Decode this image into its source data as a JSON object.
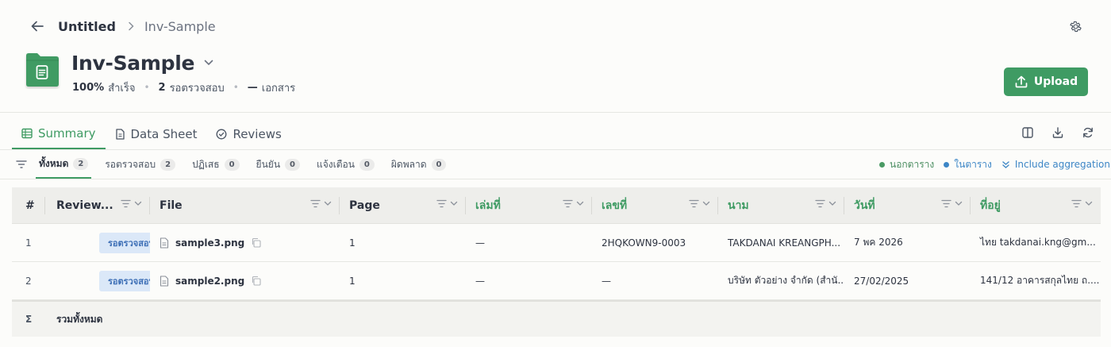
{
  "breadcrumb": {
    "root": "Untitled",
    "current": "Inv-Sample"
  },
  "header": {
    "title": "Inv-Sample",
    "progress_value": "100%",
    "progress_label": "สำเร็จ",
    "pending_count": "2",
    "pending_label": "รอตรวจสอบ",
    "doc_count": "—",
    "doc_label": "เอกสาร",
    "upload_label": "Upload"
  },
  "tabs": [
    {
      "label": "Summary",
      "active": true
    },
    {
      "label": "Data Sheet",
      "active": false
    },
    {
      "label": "Reviews",
      "active": false
    }
  ],
  "filters": [
    {
      "label": "ทั้งหมด",
      "count": "2",
      "active": true
    },
    {
      "label": "รอตรวจสอบ",
      "count": "2"
    },
    {
      "label": "ปฏิเสธ",
      "count": "0"
    },
    {
      "label": "ยืนยัน",
      "count": "0"
    },
    {
      "label": "แจ้งเตือน",
      "count": "0"
    },
    {
      "label": "ผิดพลาด",
      "count": "0"
    }
  ],
  "legend": {
    "outside": "นอกตาราง",
    "inside": "ในตาราง",
    "aggregation": "Include aggregation",
    "outside_color": "#4a9a64",
    "inside_color": "#3d86c6"
  },
  "table": {
    "columns": [
      "#",
      "Review...",
      "File",
      "Page",
      "เล่มที่",
      "เลขที่",
      "นาม",
      "วันที่",
      "ที่อยู่"
    ],
    "rows": [
      {
        "num": "1",
        "status": "รอตรวจสอบ",
        "file": "sample3.png",
        "page": "1",
        "book": "—",
        "number": "2HQKOWN9-0003",
        "name": "TAKDANAI KREANGPH...",
        "date": "7 พค 2026",
        "address": "ไทย takdanai.kng@gm..."
      },
      {
        "num": "2",
        "status": "รอตรวจสอบ",
        "file": "sample2.png",
        "page": "1",
        "book": "—",
        "number": "—",
        "name": "บริษัท ตัวอย่าง จำกัด (สำนั...",
        "date": "27/02/2025",
        "address": "141/12 อาคารสกุลไทย ถ...."
      }
    ],
    "footer": {
      "symbol": "Σ",
      "label": "รวมทั้งหมด"
    }
  },
  "colors": {
    "accent": "#3f9b63",
    "badge_bg": "#dbe8f8",
    "badge_text": "#3d6fb6"
  }
}
